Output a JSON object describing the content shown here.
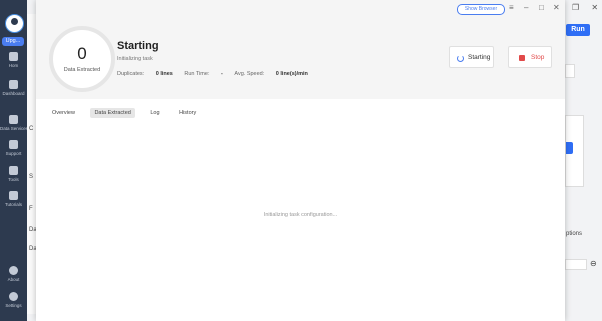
{
  "sidebar": {
    "upgrade_label": "Upg...",
    "items": [
      {
        "label": "Hom",
        "icon": "home-icon"
      },
      {
        "label": "Dashboard",
        "icon": "dashboard-icon"
      },
      {
        "label": "Data Services",
        "icon": "data-services-icon"
      },
      {
        "label": "Support",
        "icon": "headset-icon"
      },
      {
        "label": "Tools",
        "icon": "tools-icon"
      },
      {
        "label": "Tutorials",
        "icon": "tutorials-icon"
      },
      {
        "label": "About",
        "icon": "info-icon"
      },
      {
        "label": "Settings",
        "icon": "gear-icon"
      }
    ]
  },
  "background": {
    "run_label": "Run",
    "fragment_options": "ptions",
    "fragments_left": [
      "C",
      "S",
      "F",
      "Da",
      "Da"
    ]
  },
  "modal": {
    "show_browser_label": "Show Browser",
    "circle_count": "0",
    "circle_label": "Data Extracted",
    "status_title": "Starting",
    "status_subtitle": "Initializing task",
    "stats": {
      "duplicates_label": "Duplicates:",
      "duplicates_value": "0 lines",
      "runtime_label": "Run Time:",
      "runtime_value": "-",
      "speed_label": "Avg. Speed:",
      "speed_value": "0 line(s)/min"
    },
    "starting_button": "Starting",
    "stop_button": "Stop",
    "tabs": [
      {
        "label": "Overview",
        "active": false
      },
      {
        "label": "Data Extracted",
        "active": true
      },
      {
        "label": "Log",
        "active": false
      },
      {
        "label": "History",
        "active": false
      }
    ],
    "loading_message": "Initializing task configuration..."
  },
  "colors": {
    "sidebar_bg": "#2d3a4f",
    "accent_blue": "#2f6ef5",
    "stop_red": "#e14a4a"
  }
}
